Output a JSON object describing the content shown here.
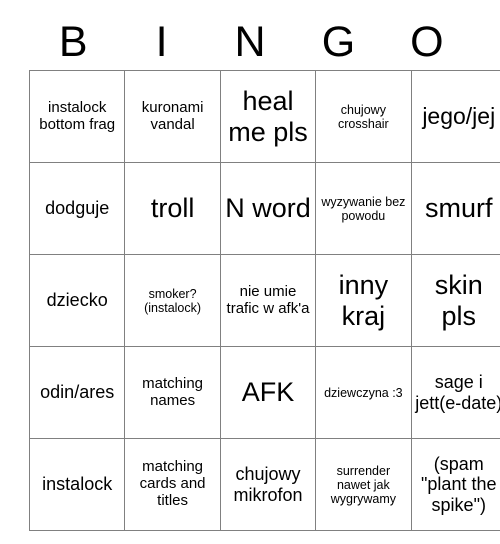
{
  "card": {
    "header_letters": [
      "B",
      "I",
      "N",
      "G",
      "O"
    ],
    "rows": [
      [
        {
          "text": "instalock bottom frag",
          "size": "s-sm"
        },
        {
          "text": "kuronami vandal",
          "size": "s-sm"
        },
        {
          "text": "heal me pls",
          "size": "s-xl"
        },
        {
          "text": "chujowy crosshair",
          "size": "s-xs"
        },
        {
          "text": "jego/jej",
          "size": "s-lg"
        }
      ],
      [
        {
          "text": "dodguje",
          "size": "s-md"
        },
        {
          "text": "troll",
          "size": "s-xl"
        },
        {
          "text": "N word",
          "size": "s-xl"
        },
        {
          "text": "wyzywanie bez powodu",
          "size": "s-xs"
        },
        {
          "text": "smurf",
          "size": "s-xl"
        }
      ],
      [
        {
          "text": "dziecko",
          "size": "s-md"
        },
        {
          "text": "smoker? (instalock)",
          "size": "s-xs"
        },
        {
          "text": "nie umie trafic w afk'a",
          "size": "s-sm"
        },
        {
          "text": "inny kraj",
          "size": "s-xl"
        },
        {
          "text": "skin pls",
          "size": "s-xl"
        }
      ],
      [
        {
          "text": "odin/ares",
          "size": "s-md"
        },
        {
          "text": "matching names",
          "size": "s-sm"
        },
        {
          "text": "AFK",
          "size": "s-xl"
        },
        {
          "text": "dziewczyna :3",
          "size": "s-xs"
        },
        {
          "text": "sage i jett(e-date)",
          "size": "s-md"
        }
      ],
      [
        {
          "text": "instalock",
          "size": "s-md"
        },
        {
          "text": "matching cards and titles",
          "size": "s-sm"
        },
        {
          "text": "chujowy mikrofon",
          "size": "s-md"
        },
        {
          "text": "surrender nawet jak wygrywamy",
          "size": "s-xs"
        },
        {
          "text": "(spam \"plant the spike\")",
          "size": "s-md"
        }
      ]
    ]
  },
  "colors": {
    "background": "#ffffff",
    "text": "#000000",
    "grid_line": "#808080"
  }
}
